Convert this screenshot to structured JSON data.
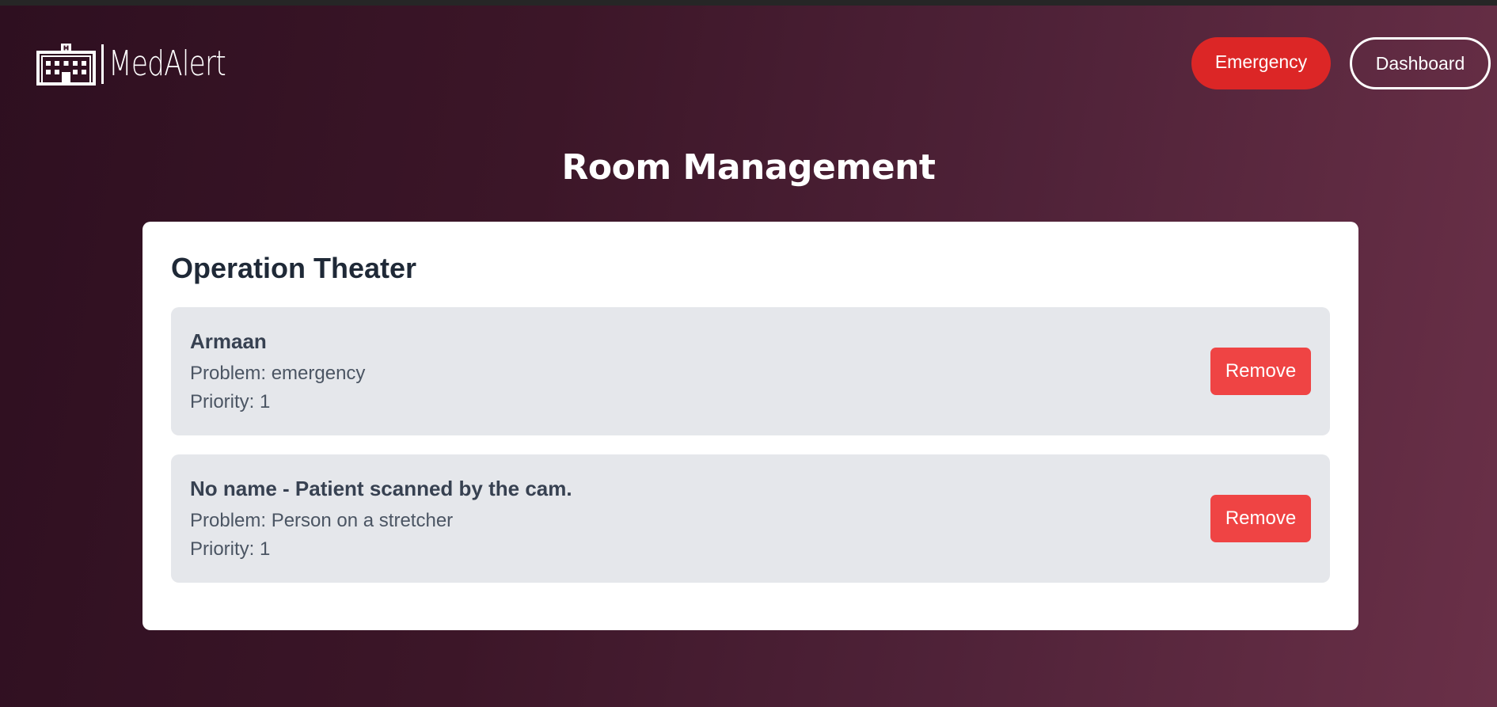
{
  "header": {
    "logo_text": "MedAlert",
    "logo_icon": "hospital-building-icon",
    "emergency_label": "Emergency",
    "dashboard_label": "Dashboard"
  },
  "page": {
    "title": "Room Management"
  },
  "room": {
    "name": "Operation Theater",
    "patients": [
      {
        "name": "Armaan",
        "problem": "Problem: emergency",
        "priority": "Priority: 1",
        "remove_label": "Remove"
      },
      {
        "name": "No name - Patient scanned by the cam.",
        "problem": "Problem: Person on a stretcher",
        "priority": "Priority: 1",
        "remove_label": "Remove"
      }
    ]
  },
  "colors": {
    "emergency": "#dc2626",
    "remove": "#ef4444",
    "card_bg": "#ffffff",
    "patient_bg": "#e5e7eb",
    "background_start": "#2e0f20",
    "background_end": "#6a3048"
  }
}
